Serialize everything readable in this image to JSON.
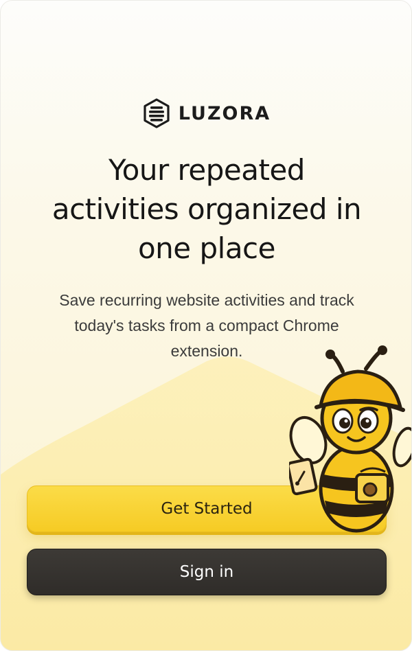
{
  "brand": {
    "name": "LUZORA",
    "logo_icon": "hexagon-stack-icon"
  },
  "hero": {
    "headline_line1": "Your repeated",
    "headline_line2": "activities organized in",
    "headline_line3": "one place",
    "subtitle_line1": "Save recurring website activities and track",
    "subtitle_line2": "today's tasks from a compact Chrome",
    "subtitle_line3": "extension."
  },
  "actions": {
    "get_started_label": "Get Started",
    "sign_in_label": "Sign in"
  },
  "mascot": {
    "icon": "bee-mascot-icon"
  },
  "colors": {
    "accent_yellow": "#F7CE2E",
    "dark_button": "#33302D",
    "background_cream": "#FCF6DF",
    "text_primary": "#161616"
  }
}
